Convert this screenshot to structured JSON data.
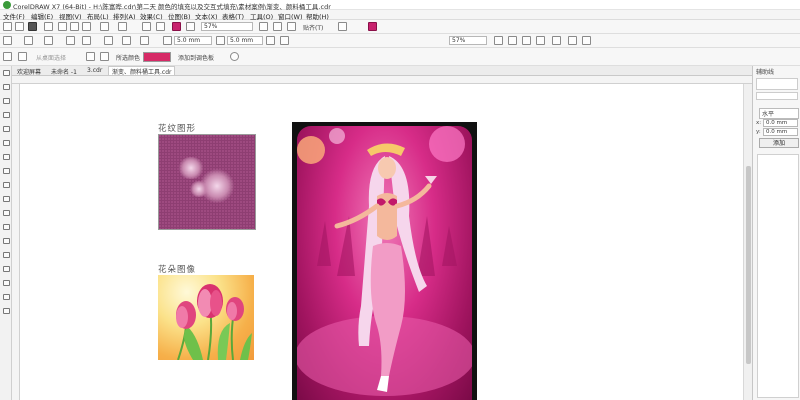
{
  "window": {
    "title": "CorelDRAW X7 (64-Bit) - H:\\陈富晔.cdr\\第二天 颜色的填充以及交互式填充\\素材案例\\渐变、颜料桶工具.cdr"
  },
  "menu": [
    "文件(F)",
    "编辑(E)",
    "视图(V)",
    "布局(L)",
    "排列(A)",
    "效果(C)",
    "位图(B)",
    "文本(X)",
    "表格(T)",
    "工具(O)",
    "窗口(W)",
    "帮助(H)"
  ],
  "toolbar1": {
    "zoom": "57%",
    "snap_label": "贴齐(T)"
  },
  "toolbar2": {
    "nudge1": "5.0 mm",
    "nudge2": "5.0 mm",
    "zoom2": "57%"
  },
  "colorbar": {
    "from_desktop": "从桌面选择",
    "selected_color_label": "所选颜色",
    "selected_color": "#d62a66",
    "add_to_palette": "添加到调色板"
  },
  "tabs": [
    "欢迎屏幕",
    "未命名 -1",
    "3.cdr",
    "渐变、颜料桶工具.cdr"
  ],
  "active_tab": 3,
  "right_panel": {
    "title": "辅助线",
    "orientation": "水平",
    "x_value": "0.0 mm",
    "y_value": "0.0 mm",
    "add_button": "添加"
  },
  "canvas": {
    "caption_pattern": "花纹图形",
    "caption_image": "花朵图像"
  },
  "colors": {
    "poster_pink": "#d72c88",
    "pattern_purple": "#8e3e72"
  }
}
